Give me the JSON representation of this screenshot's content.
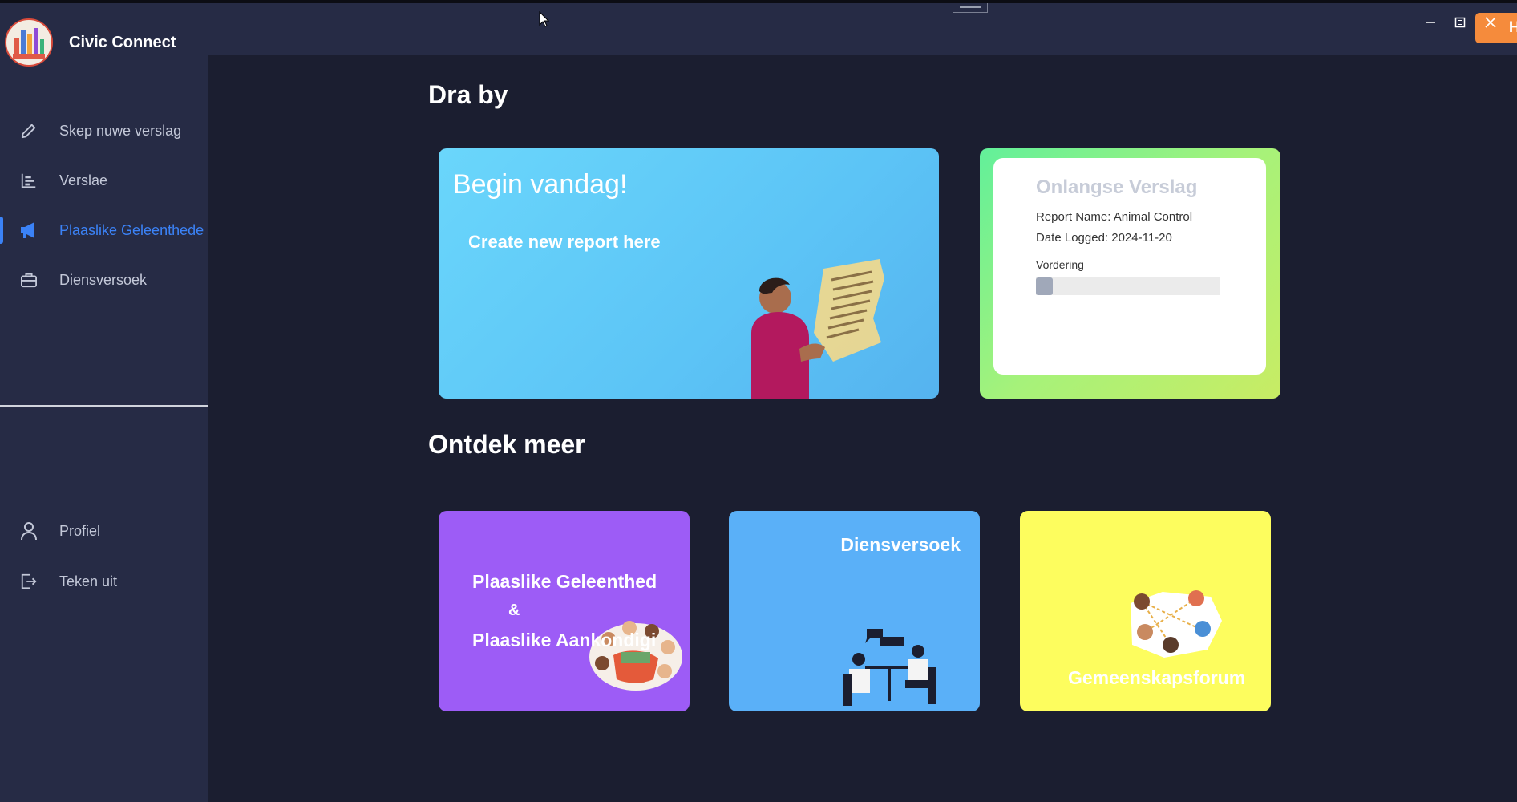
{
  "app": {
    "name": "Civic Connect"
  },
  "sidebar": {
    "items": [
      {
        "label": "Skep nuwe verslag",
        "icon": "pencil-icon"
      },
      {
        "label": "Verslae",
        "icon": "chart-icon"
      },
      {
        "label": "Plaaslike Geleenthede",
        "icon": "megaphone-icon",
        "active": true
      },
      {
        "label": "Diensversoek",
        "icon": "briefcase-icon"
      }
    ],
    "bottom_items": [
      {
        "label": "Profiel",
        "icon": "user-icon"
      },
      {
        "label": "Teken uit",
        "icon": "logout-icon"
      }
    ]
  },
  "topbar": {
    "home_button": "Huis"
  },
  "main": {
    "section_contribute": "Dra by",
    "begin_card": {
      "title": "Begin vandag!",
      "subtitle": "Create new report here"
    },
    "recent_card": {
      "title": "Onlangse Verslag",
      "report_name": "Report Name: Animal Control",
      "date_logged": "Date Logged: 2024-11-20",
      "progress_label": "Vordering",
      "progress_fraction": 0.09
    },
    "section_discover": "Ontdek meer",
    "tiles": {
      "events_line1": "Plaaslike Geleenthede",
      "events_amp": "&",
      "events_line2": "Plaaslike Aankondigings",
      "service": "Diensversoek",
      "forum": "Gemeenskapsforum"
    }
  },
  "colors": {
    "accent": "#3b82f6",
    "home_button": "#f58b3c",
    "sidebar_bg": "#262b45",
    "main_bg": "#1b1e30",
    "events_tile": "#9d5cf6",
    "service_tile": "#5ab0f8",
    "forum_tile": "#fdfd5e"
  }
}
